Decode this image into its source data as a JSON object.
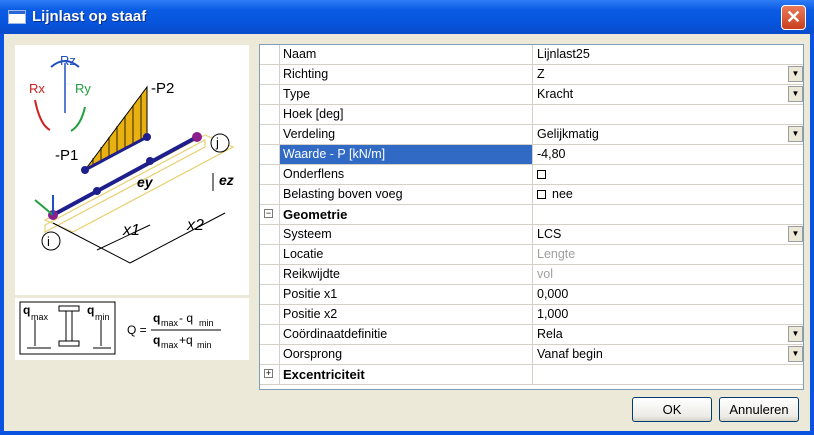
{
  "window": {
    "title": "Lijnlast op staaf",
    "close_symbol": "✕"
  },
  "diagram": {
    "labels": {
      "rz": "Rz",
      "rx": "Rx",
      "ry": "Ry",
      "p1": "-P1",
      "p2": "-P2",
      "node_i": "i",
      "node_j": "j",
      "ey": "ey",
      "ez": "ez",
      "x1": "x1",
      "x2": "x2"
    },
    "colors": {
      "beam": "#1e1e8c",
      "load": "#e8b010",
      "node": "#8b1e8b",
      "rz": "#2050c0",
      "rx": "#d02020",
      "ry": "#20a040"
    }
  },
  "formula": {
    "qmax": "q",
    "qmax_sub": "max",
    "qmin": "q",
    "qmin_sub": "min",
    "lhs": "Q =",
    "num": "q",
    "num_sub1": "max",
    "minus": "- q",
    "num_sub2": "min",
    "den": "q",
    "den_sub1": "max",
    "plus": "+q",
    "den_sub2": "min"
  },
  "properties": [
    {
      "name": "Naam",
      "value": "Lijnlast25"
    },
    {
      "name": "Richting",
      "value": "Z",
      "dropdown": true
    },
    {
      "name": "Type",
      "value": "Kracht",
      "dropdown": true
    },
    {
      "name": "Hoek [deg]",
      "value": ""
    },
    {
      "name": "Verdeling",
      "value": "Gelijkmatig",
      "dropdown": true
    },
    {
      "name": "Waarde - P [kN/m]",
      "value": "-4,80",
      "selected": true
    },
    {
      "name": "Onderflens",
      "value": "",
      "checkbox": true
    },
    {
      "name": "Belasting boven voeg",
      "value": "nee",
      "checkbox": true
    },
    {
      "name": "Geometrie",
      "value": "",
      "category": true,
      "expander": "−"
    },
    {
      "name": "Systeem",
      "value": "LCS",
      "dropdown": true
    },
    {
      "name": "Locatie",
      "value": "Lengte",
      "gray": true
    },
    {
      "name": "Reikwijdte",
      "value": "vol",
      "gray": true
    },
    {
      "name": "Positie x1",
      "value": "0,000"
    },
    {
      "name": "Positie x2",
      "value": "1,000"
    },
    {
      "name": "Coördinaatdefinitie",
      "value": "Rela",
      "dropdown": true
    },
    {
      "name": "Oorsprong",
      "value": "Vanaf begin",
      "dropdown": true
    },
    {
      "name": "Excentriciteit",
      "value": "",
      "category": true,
      "expander": "+"
    }
  ],
  "dropdown_arrow": "▼",
  "buttons": {
    "ok": "OK",
    "cancel": "Annuleren"
  }
}
